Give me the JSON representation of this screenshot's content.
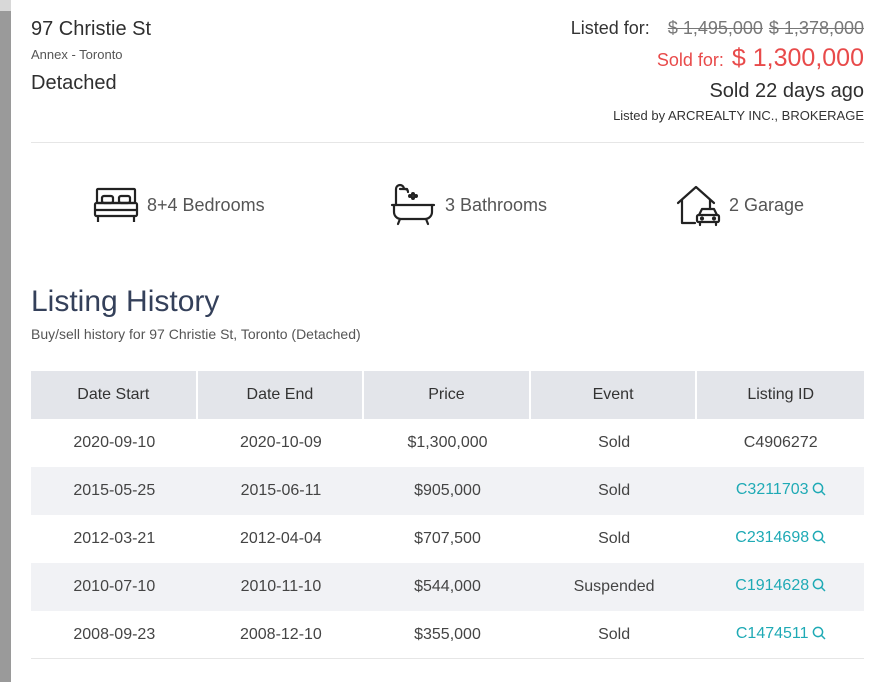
{
  "listing": {
    "address": "97 Christie St",
    "area": "Annex - Toronto",
    "type": "Detached"
  },
  "pricing": {
    "listed_label": "Listed for:",
    "old_prices": [
      "$ 1,495,000",
      "$ 1,378,000"
    ],
    "sold_label": "Sold for:",
    "sold_price": "$ 1,300,000",
    "sold_ago": "Sold 22 days ago",
    "listed_by": "Listed by ARCREALTY INC., BROKERAGE",
    "colors": {
      "sold": "#e84a4a",
      "strike": "#777777"
    }
  },
  "features": [
    {
      "icon": "bed-icon",
      "label": "8+4 Bedrooms"
    },
    {
      "icon": "bathtub-icon",
      "label": "3 Bathrooms"
    },
    {
      "icon": "garage-icon",
      "label": "2 Garage"
    }
  ],
  "history": {
    "title": "Listing History",
    "subtitle": "Buy/sell history for 97 Christie St, Toronto (Detached)",
    "columns": [
      "Date Start",
      "Date End",
      "Price",
      "Event",
      "Listing ID"
    ],
    "rows": [
      {
        "start": "2020-09-10",
        "end": "2020-10-09",
        "price": "$1,300,000",
        "event": "Sold",
        "id": "C4906272",
        "link": false
      },
      {
        "start": "2015-05-25",
        "end": "2015-06-11",
        "price": "$905,000",
        "event": "Sold",
        "id": "C3211703",
        "link": true
      },
      {
        "start": "2012-03-21",
        "end": "2012-04-04",
        "price": "$707,500",
        "event": "Sold",
        "id": "C2314698",
        "link": true
      },
      {
        "start": "2010-07-10",
        "end": "2010-11-10",
        "price": "$544,000",
        "event": "Suspended",
        "id": "C1914628",
        "link": true
      },
      {
        "start": "2008-09-23",
        "end": "2008-12-10",
        "price": "$355,000",
        "event": "Sold",
        "id": "C1474511",
        "link": true
      }
    ],
    "colors": {
      "link": "#1faab5",
      "header_bg": "#e3e5ea",
      "stripe_bg": "#f1f2f5",
      "title": "#34405a"
    }
  }
}
